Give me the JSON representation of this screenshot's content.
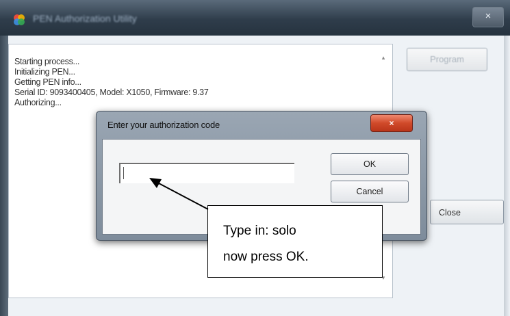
{
  "main_window": {
    "title": "PEN Authorization Utility",
    "close_label": "×",
    "scroll_up": "▴",
    "scroll_down": "▾",
    "log_lines": [
      "Starting process...",
      "Initializing PEN...",
      "Getting PEN info...",
      "Serial ID: 9093400405, Model: X1050, Firmware: 9.37",
      "Authorizing..."
    ],
    "program_button": "Program",
    "close_button": "Close"
  },
  "dialog": {
    "title": "Enter your authorization code",
    "close_label": "×",
    "input_value": "",
    "ok_button": "OK",
    "cancel_button": "Cancel"
  },
  "annotation": {
    "line1": "Type in:  solo",
    "line2": "now press OK."
  },
  "colors": {
    "titlebar": "#2f3d4b",
    "dialog_close": "#d04a2a",
    "dialog_frame": "#8a97a5"
  }
}
